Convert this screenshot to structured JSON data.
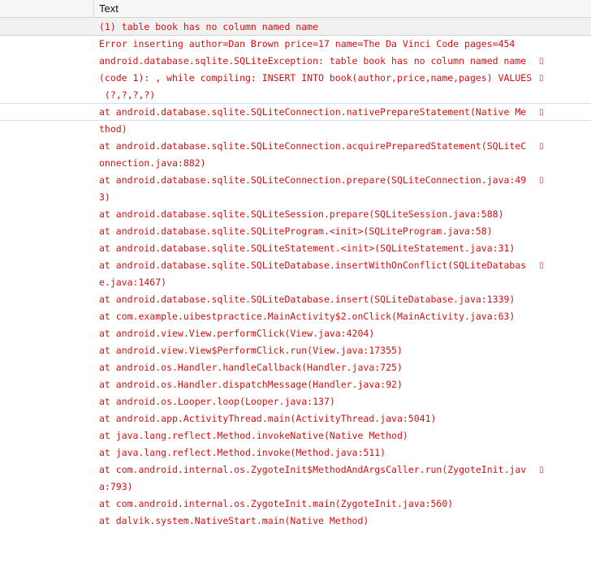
{
  "header": {
    "column_title": "Text"
  },
  "wrap_glyph": "▯",
  "log_lines": [
    "(1) table book has no column named name",
    "Error inserting author=Dan Brown price=17 name=The Da Vinci Code pages=454",
    "android.database.sqlite.SQLiteException: table book has no column named name",
    "(code 1): , while compiling: INSERT INTO book(author,price,name,pages) VALUES",
    " (?,?,?,?)",
    "at android.database.sqlite.SQLiteConnection.nativePrepareStatement(Native Me",
    "thod)",
    "at android.database.sqlite.SQLiteConnection.acquirePreparedStatement(SQLiteC",
    "onnection.java:882)",
    "at android.database.sqlite.SQLiteConnection.prepare(SQLiteConnection.java:49",
    "3)",
    "at android.database.sqlite.SQLiteSession.prepare(SQLiteSession.java:588)",
    "at android.database.sqlite.SQLiteProgram.<init>(SQLiteProgram.java:58)",
    "at android.database.sqlite.SQLiteStatement.<init>(SQLiteStatement.java:31)",
    "at android.database.sqlite.SQLiteDatabase.insertWithOnConflict(SQLiteDatabas",
    "e.java:1467)",
    "at android.database.sqlite.SQLiteDatabase.insert(SQLiteDatabase.java:1339)",
    "at com.example.uibestpractice.MainActivity$2.onClick(MainActivity.java:63)",
    "at android.view.View.performClick(View.java:4204)",
    "at android.view.View$PerformClick.run(View.java:17355)",
    "at android.os.Handler.handleCallback(Handler.java:725)",
    "at android.os.Handler.dispatchMessage(Handler.java:92)",
    "at android.os.Looper.loop(Looper.java:137)",
    "at android.app.ActivityThread.main(ActivityThread.java:5041)",
    "at java.lang.reflect.Method.invokeNative(Native Method)",
    "at java.lang.reflect.Method.invoke(Method.java:511)",
    "at com.android.internal.os.ZygoteInit$MethodAndArgsCaller.run(ZygoteInit.jav",
    "a:793)",
    "at com.android.internal.os.ZygoteInit.main(ZygoteInit.java:560)",
    "at dalvik.system.NativeStart.main(Native Method)"
  ]
}
